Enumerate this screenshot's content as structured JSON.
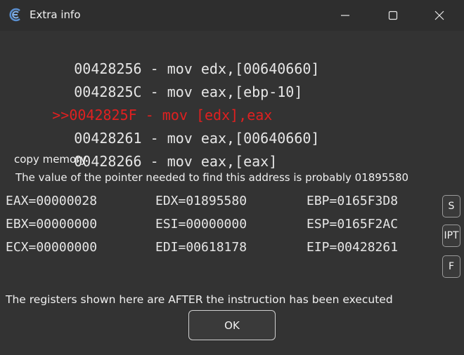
{
  "window": {
    "title": "Extra info"
  },
  "disassembly": [
    {
      "prefix": "",
      "text": "00428256 - mov edx,[00640660]",
      "highlighted": false
    },
    {
      "prefix": "",
      "text": "0042825C - mov eax,[ebp-10]",
      "highlighted": false
    },
    {
      "prefix": ">>",
      "text": "0042825F - mov [edx],eax",
      "highlighted": true
    },
    {
      "prefix": "",
      "text": "00428261 - mov eax,[00640660]",
      "highlighted": false
    },
    {
      "prefix": "",
      "text": "00428266 - mov eax,[eax]",
      "highlighted": false
    }
  ],
  "copy_memory_label": "copy memory",
  "pointer_text": "The value of the pointer needed to find this address is probably 01895580",
  "registers": {
    "eax": "EAX=00000028",
    "edx": "EDX=01895580",
    "ebp": "EBP=0165F3D8",
    "ebx": "EBX=00000000",
    "esi": "ESI=00000000",
    "esp": "ESP=0165F2AC",
    "ecx": "ECX=00000000",
    "edi": "EDI=00618178",
    "eip": "EIP=00428261"
  },
  "side_buttons": {
    "s": "S",
    "ipt": "IPT",
    "f": "F"
  },
  "footer_note": "The registers shown here are AFTER the instruction has been executed",
  "ok_label": "OK",
  "colors": {
    "highlight": "#e02020",
    "background": "#333333"
  }
}
